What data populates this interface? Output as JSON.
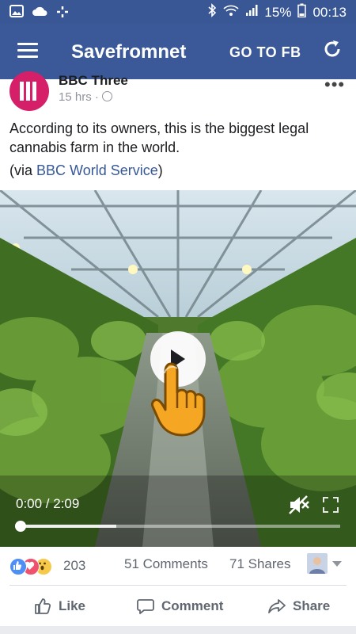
{
  "status_bar": {
    "battery": "15%",
    "time": "00:13"
  },
  "app_bar": {
    "title": "Savefromnet",
    "go_to_fb": "GO TO FB"
  },
  "post": {
    "author": "BBC Three",
    "time": "15 hrs ·",
    "text": "According to its owners, this is the biggest legal cannabis farm in the world.",
    "via_prefix": "(via ",
    "via_link": "BBC World Service",
    "via_suffix": ")"
  },
  "video": {
    "time_display": "0:00 / 2:09",
    "progress_fraction": 0.0,
    "buffered_fraction": 0.3
  },
  "reactions": {
    "count": "203",
    "comments": "51 Comments",
    "shares": "71 Shares"
  },
  "actions": {
    "like": "Like",
    "comment": "Comment",
    "share": "Share"
  },
  "colors": {
    "appbar": "#3b5998",
    "link": "#365899",
    "avatar": "#d61f69"
  }
}
